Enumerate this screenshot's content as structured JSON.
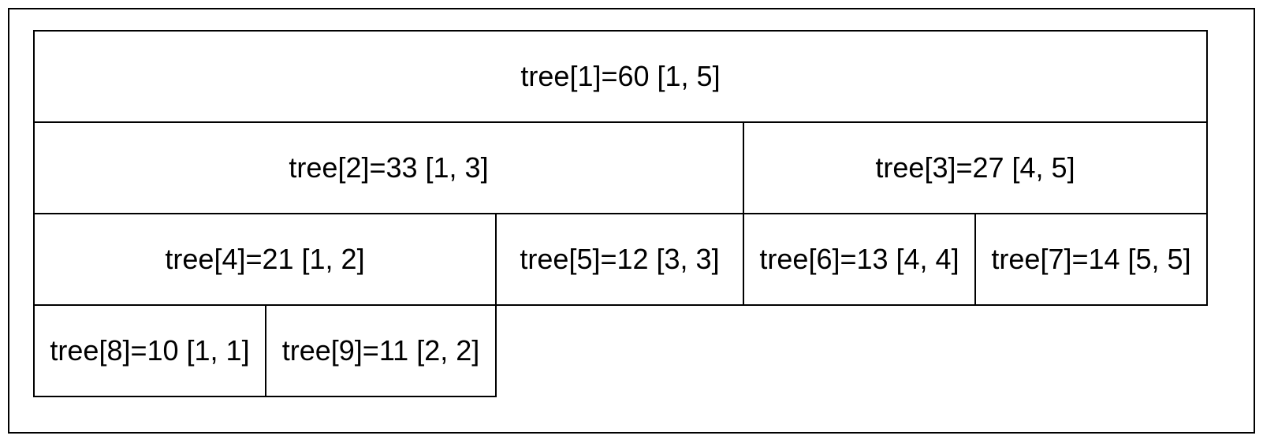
{
  "nodes": {
    "n1": "tree[1]=60 [1, 5]",
    "n2": "tree[2]=33 [1, 3]",
    "n3": "tree[3]=27 [4, 5]",
    "n4": "tree[4]=21 [1, 2]",
    "n5": "tree[5]=12 [3, 3]",
    "n6": "tree[6]=13 [4, 4]",
    "n7": "tree[7]=14 [5, 5]",
    "n8": "tree[8]=10 [1, 1]",
    "n9": "tree[9]=11 [2, 2]"
  },
  "chart_data": {
    "type": "tree",
    "structure": "segment-tree",
    "array_size": 5,
    "nodes": [
      {
        "index": 1,
        "value": 60,
        "range": [
          1,
          5
        ],
        "children": [
          2,
          3
        ]
      },
      {
        "index": 2,
        "value": 33,
        "range": [
          1,
          3
        ],
        "children": [
          4,
          5
        ]
      },
      {
        "index": 3,
        "value": 27,
        "range": [
          4,
          5
        ],
        "children": [
          6,
          7
        ]
      },
      {
        "index": 4,
        "value": 21,
        "range": [
          1,
          2
        ],
        "children": [
          8,
          9
        ]
      },
      {
        "index": 5,
        "value": 12,
        "range": [
          3,
          3
        ],
        "children": []
      },
      {
        "index": 6,
        "value": 13,
        "range": [
          4,
          4
        ],
        "children": []
      },
      {
        "index": 7,
        "value": 14,
        "range": [
          5,
          5
        ],
        "children": []
      },
      {
        "index": 8,
        "value": 10,
        "range": [
          1,
          1
        ],
        "children": []
      },
      {
        "index": 9,
        "value": 11,
        "range": [
          2,
          2
        ],
        "children": []
      }
    ]
  }
}
